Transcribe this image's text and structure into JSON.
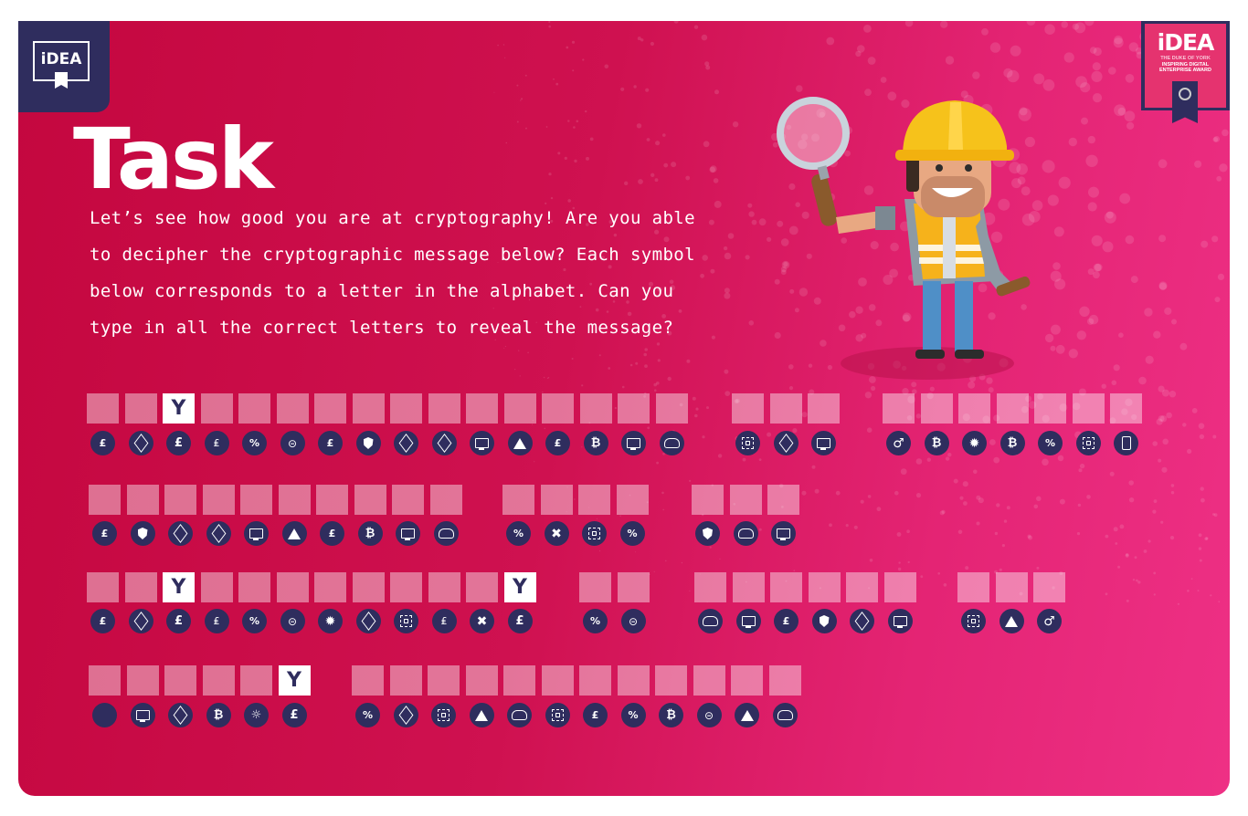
{
  "header": {
    "left_logo": "iDEA",
    "award": {
      "brand": "iDEA",
      "line1": "THE DUKE OF YORK",
      "line2": "INSPIRING DIGITAL",
      "line3": "ENTERPRISE AWARD"
    }
  },
  "task": {
    "title": "Task",
    "instructions_lines": [
      "Let’s see how good you are at cryptography! Are you able",
      "to decipher the cryptographic message below? Each symbol",
      "below corresponds to a letter in the alphabet. Can you",
      "type in all the correct letters to reveal the message?"
    ]
  },
  "colors": {
    "navy": "#2f2d5e",
    "pink_dark": "#c4073f",
    "pink_light": "#ee3085",
    "cell_empty": "rgba(255,255,255,0.42)"
  },
  "symbol_icons": {
    "moneybag": "money-bag-icon",
    "cube": "cube-icon",
    "pound": "pound-coin-icon",
    "piggy": "piggy-bank-icon",
    "percent": "percent-icon",
    "lockcircle": "lock-circle-icon",
    "shield": "shield-icon",
    "screen": "computer-screen-icon",
    "warning": "warning-icon",
    "bitcoin": "bitcoin-icon",
    "cloudlock": "cloud-lock-icon",
    "chip": "microchip-icon",
    "key": "key-icon",
    "bug": "bug-icon",
    "phone": "phone-icon",
    "skull": "skull-crossbones-icon",
    "alarm": "alarm-light-icon",
    "blank": "blank-icon"
  },
  "puzzle": {
    "rows": [
      {
        "words": [
          {
            "cells": [
              "",
              "",
              "Y",
              "",
              "",
              "",
              "",
              "",
              "",
              "",
              "",
              "",
              "",
              "",
              "",
              ""
            ],
            "symbols": [
              "moneybag",
              "cube",
              "pound",
              "piggy",
              "percent",
              "lockcircle",
              "moneybag",
              "shield",
              "cube",
              "cube",
              "screen",
              "warning",
              "moneybag",
              "bitcoin",
              "screen",
              "cloudlock"
            ]
          },
          {
            "cells": [
              "",
              "",
              ""
            ],
            "symbols": [
              "chip",
              "cube",
              "screen"
            ]
          },
          {
            "cells": [
              "",
              "",
              "",
              "",
              "",
              "",
              ""
            ],
            "symbols": [
              "key",
              "bitcoin",
              "bug",
              "bitcoin",
              "percent",
              "chip",
              "phone"
            ]
          }
        ]
      },
      {
        "words": [
          {
            "cells": [
              "",
              "",
              "",
              "",
              "",
              "",
              "",
              "",
              "",
              ""
            ],
            "symbols": [
              "moneybag",
              "shield",
              "cube",
              "cube",
              "screen",
              "warning",
              "moneybag",
              "bitcoin",
              "screen",
              "cloudlock"
            ]
          },
          {
            "cells": [
              "",
              "",
              "",
              ""
            ],
            "symbols": [
              "percent",
              "skull",
              "chip",
              "percent"
            ]
          },
          {
            "cells": [
              "",
              "",
              ""
            ],
            "symbols": [
              "shield",
              "cloudlock",
              "screen"
            ]
          }
        ]
      },
      {
        "words": [
          {
            "cells": [
              "",
              "",
              "Y",
              "",
              "",
              "",
              "",
              "",
              "",
              "",
              "",
              "Y"
            ],
            "symbols": [
              "moneybag",
              "cube",
              "pound",
              "piggy",
              "percent",
              "lockcircle",
              "bug",
              "cube",
              "chip",
              "piggy",
              "skull",
              "pound"
            ]
          },
          {
            "cells": [
              "",
              ""
            ],
            "symbols": [
              "percent",
              "lockcircle"
            ]
          },
          {
            "cells": [
              "",
              "",
              "",
              "",
              "",
              ""
            ],
            "symbols": [
              "cloudlock",
              "screen",
              "moneybag",
              "shield",
              "cube",
              "screen"
            ]
          },
          {
            "cells": [
              "",
              "",
              ""
            ],
            "symbols": [
              "chip",
              "warning",
              "key"
            ]
          }
        ]
      },
      {
        "words": [
          {
            "cells": [
              "",
              "",
              "",
              "",
              "",
              "Y"
            ],
            "symbols": [
              "blank",
              "screen",
              "cube",
              "bitcoin",
              "alarm",
              "pound"
            ]
          },
          {
            "cells": [
              "",
              "",
              "",
              "",
              "",
              "",
              "",
              "",
              "",
              "",
              "",
              ""
            ],
            "symbols": [
              "percent",
              "cube",
              "chip",
              "warning",
              "cloudlock",
              "chip",
              "moneybag",
              "percent",
              "bitcoin",
              "lockcircle",
              "warning",
              "cloudlock"
            ]
          }
        ]
      }
    ]
  }
}
